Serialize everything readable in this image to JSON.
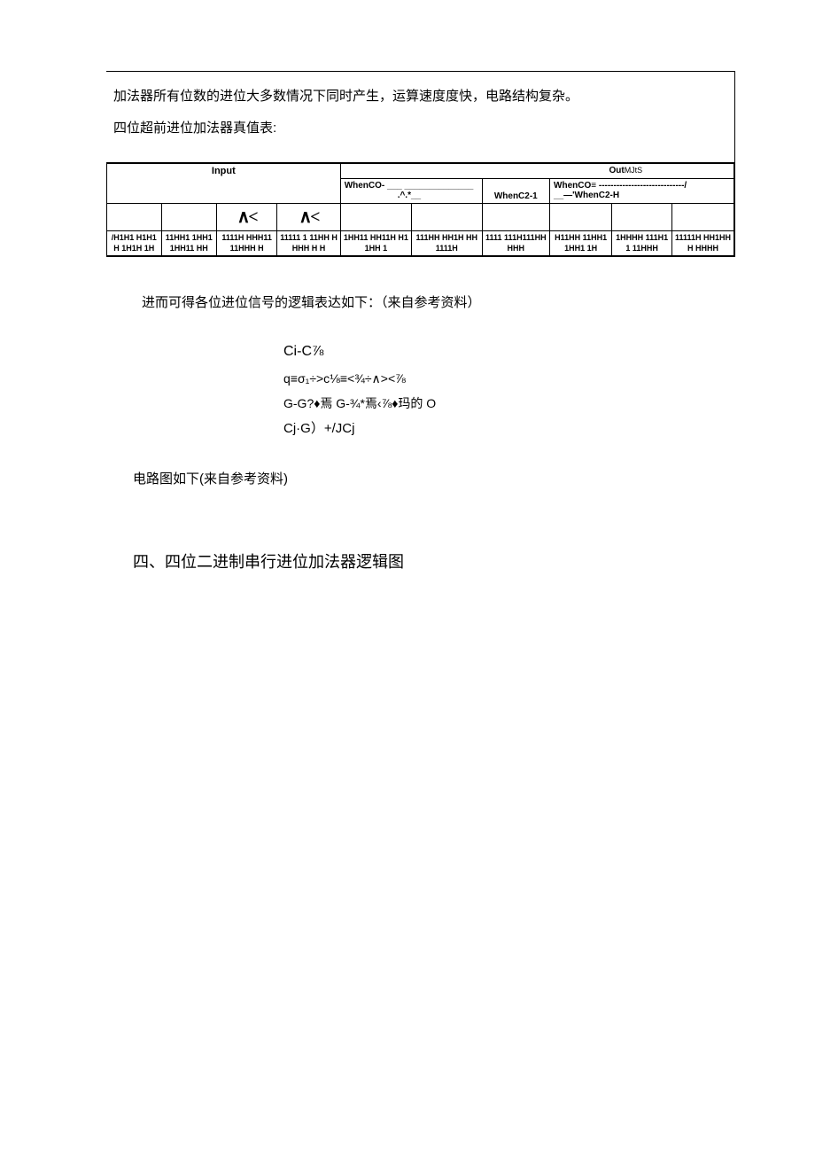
{
  "box": {
    "p1": "加法器所有位数的进位大多数情况下同时产生，运算速度度快，电路结构复杂。",
    "p2": "四位超前进位加法器真值表:"
  },
  "table": {
    "input_label": "Input",
    "out_label": "Out",
    "out_suffix": "MJtS",
    "whenco_left": "WhenCO-",
    "whenco_left_sub": ".^.*__",
    "whenc2_1": "WhenC2-1",
    "whenco_right": "WhenCO≡ -----------------------------/",
    "whenc2_h": "__—'WhenC2-H",
    "sym1": "∧<",
    "sym2": "∧<",
    "cells": {
      "c0": "/H1H1 H1H1H 1H1H 1H",
      "c1": "11HH1 1HH1 1HH11 HH",
      "c2": "1111H HHH11 11HHH H",
      "c3": "11111 1 11HH HHHH H H",
      "c4": "1HH11 HH11H H11HH 1",
      "c5": "111HH HH1H HH 1111H",
      "c6": "1111 111H111HH HHH",
      "c7": "H11HH 11HH1 1HH1 1H",
      "c8": "1HHHH 111H11 11HHH",
      "c9": "11111H HH1HHH HHHH"
    }
  },
  "below": "进而可得各位进位信号的逻辑表达如下：（来自参考资料）",
  "formulas": {
    "f1": "Ci-C⅞",
    "f2": "q≡σ₁÷>c⅛≡<¾÷∧><⅞",
    "f3": "G-G?♦焉 G-¾*焉‹⅞♦玛的 O",
    "f4": "Cj·G）+/JCj"
  },
  "circuit_text": "电路图如下(来自参考资料)",
  "section4": "四、四位二进制串行进位加法器逻辑图"
}
